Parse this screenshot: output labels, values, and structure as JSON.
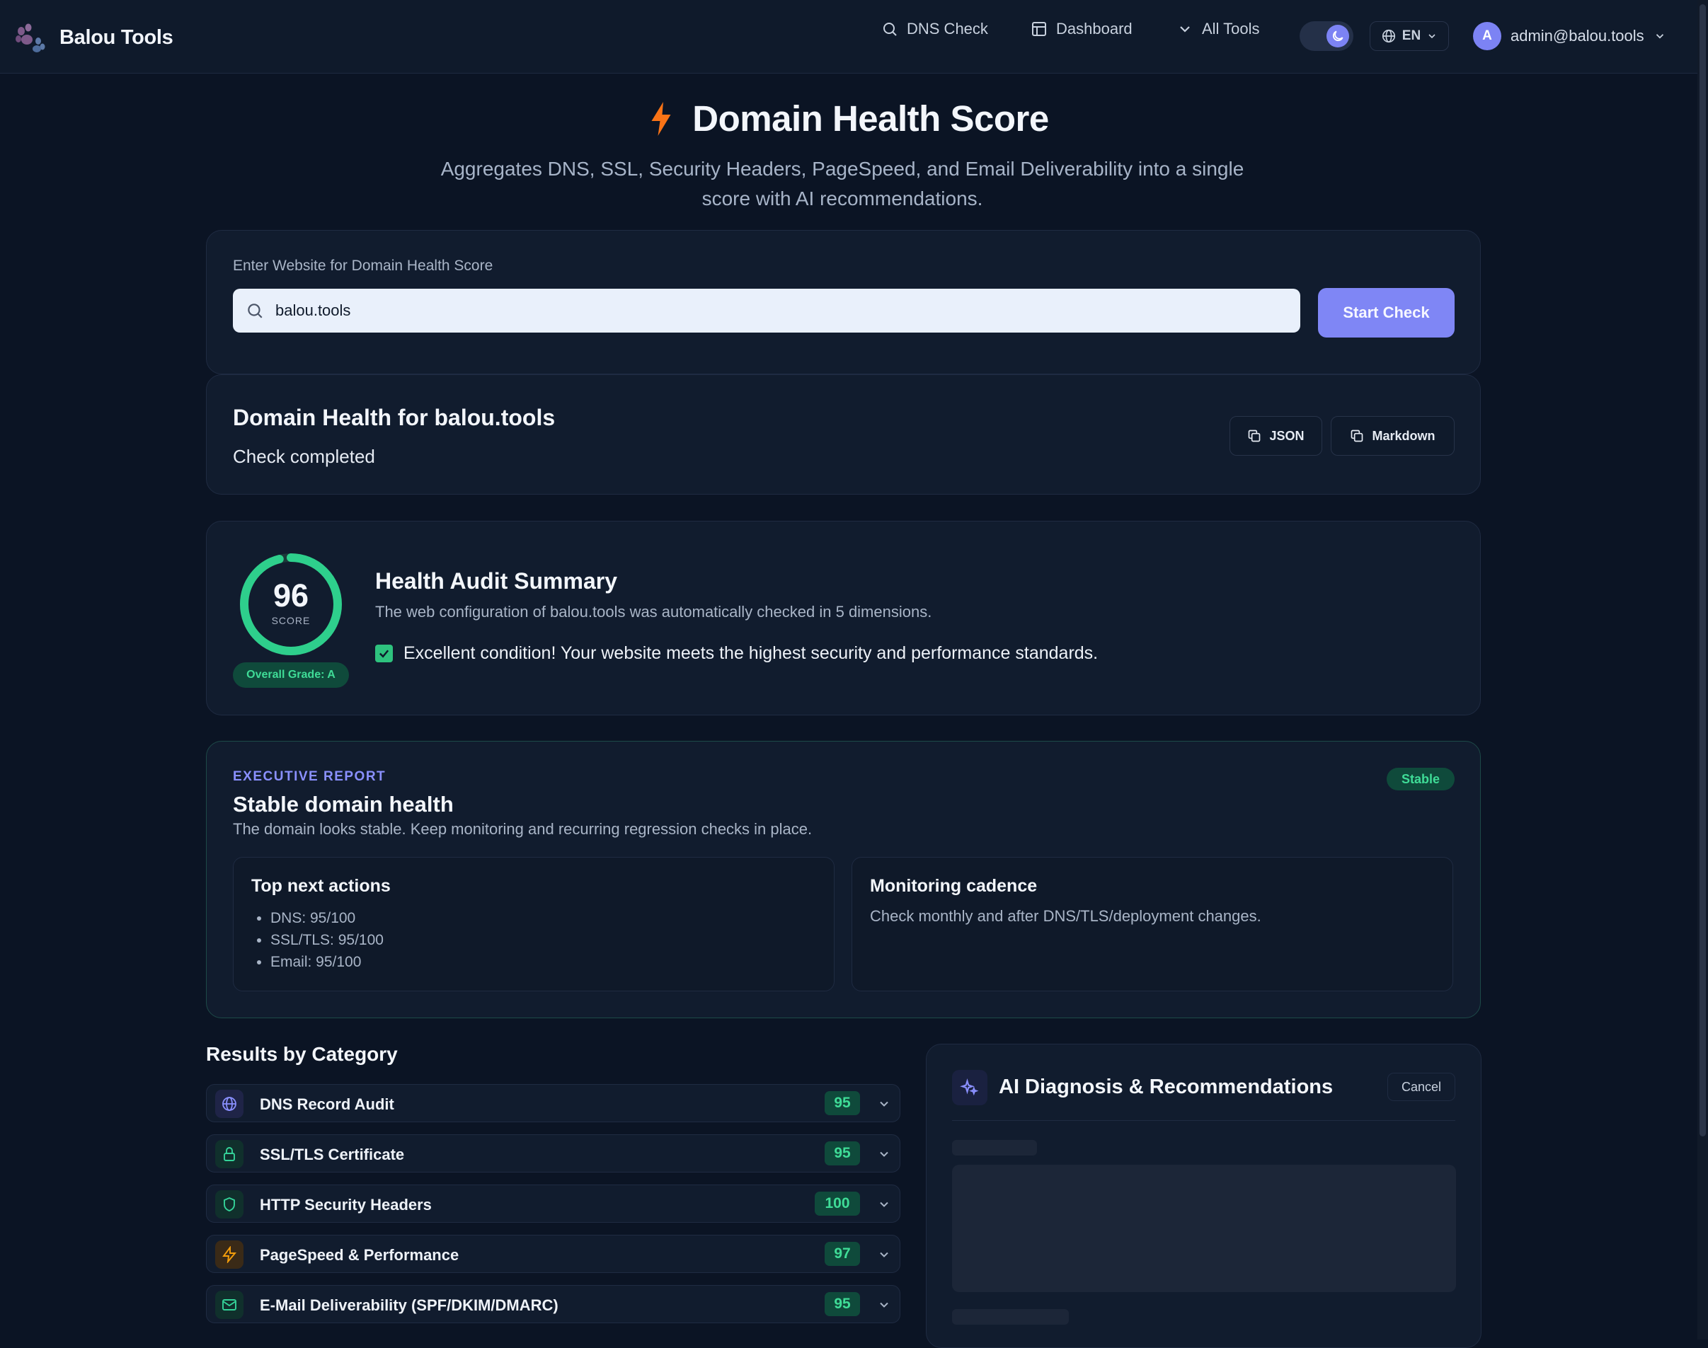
{
  "app": {
    "name": "Balou Tools"
  },
  "nav": {
    "dns_check": "DNS Check",
    "dashboard": "Dashboard",
    "all_tools": "All Tools",
    "language": "EN",
    "user_initial": "A",
    "user_email": "admin@balou.tools"
  },
  "hero": {
    "title": "Domain Health Score",
    "subtitle": "Aggregates DNS, SSL, Security Headers, PageSpeed, and Email Deliverability into a single score with AI recommendations."
  },
  "input": {
    "label": "Enter Website for Domain Health Score",
    "value": "balou.tools",
    "button": "Start Check"
  },
  "result": {
    "title": "Domain Health for balou.tools",
    "status": "Check completed",
    "json_button": "JSON",
    "markdown_button": "Markdown"
  },
  "summary": {
    "score": "96",
    "score_fraction": 0.96,
    "score_label": "SCORE",
    "grade": "Overall Grade: A",
    "title": "Health Audit Summary",
    "description": "The web configuration of balou.tools was automatically checked in 5 dimensions.",
    "verdict": "Excellent condition! Your website meets the highest security and performance standards."
  },
  "executive": {
    "eyebrow": "EXECUTIVE REPORT",
    "title": "Stable domain health",
    "description": "The domain looks stable. Keep monitoring and recurring regression checks in place.",
    "badge": "Stable",
    "actions_title": "Top next actions",
    "actions": [
      "DNS: 95/100",
      "SSL/TLS: 95/100",
      "Email: 95/100"
    ],
    "cadence_title": "Monitoring cadence",
    "cadence_text": "Check monthly and after DNS/TLS/deployment changes."
  },
  "categories": {
    "heading": "Results by Category",
    "items": [
      {
        "name": "DNS Record Audit",
        "score": "95",
        "icon": "globe-icon",
        "color": "#8a90ff"
      },
      {
        "name": "SSL/TLS Certificate",
        "score": "95",
        "icon": "lock-icon",
        "color": "#34d399"
      },
      {
        "name": "HTTP Security Headers",
        "score": "100",
        "icon": "shield-icon",
        "color": "#34d399"
      },
      {
        "name": "PageSpeed & Performance",
        "score": "97",
        "icon": "bolt-icon",
        "color": "#f59e0b"
      },
      {
        "name": "E-Mail Deliverability (SPF/DKIM/DMARC)",
        "score": "95",
        "icon": "mail-icon",
        "color": "#34d399"
      }
    ]
  },
  "ai": {
    "title": "AI Diagnosis & Recommendations",
    "cancel": "Cancel"
  },
  "colors": {
    "accent": "#7f86f5",
    "success": "#3fdc97",
    "bolt": "#f97316",
    "background": "#0b1424"
  }
}
